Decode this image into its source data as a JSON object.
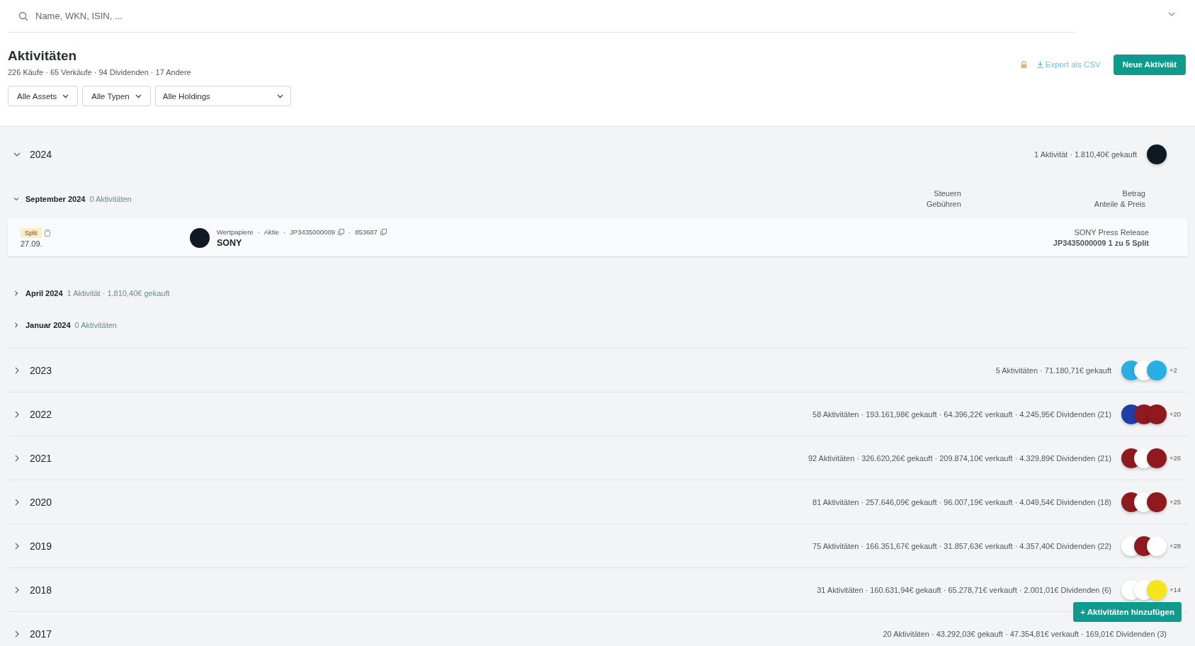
{
  "search": {
    "placeholder": "Name, WKN, ISIN, ..."
  },
  "header": {
    "title": "Aktivitäten",
    "summary": "226 Käufe · 65 Verkäufe · 94 Dividenden · 17 Andere",
    "locked": true,
    "export_label": "Export als CSV",
    "new_button": "Neue Aktivität"
  },
  "filters": [
    {
      "label": "Alle Assets",
      "wide": false
    },
    {
      "label": "Alle Typen",
      "wide": false
    },
    {
      "label": "Alle Holdings",
      "wide": true
    }
  ],
  "years": [
    {
      "year": "2024",
      "expanded": true,
      "summary": "1 Aktivität · 1.810,40€ gekauft",
      "logos": [
        {
          "color": "#0f1b24"
        }
      ],
      "columns": {
        "left": [
          "Steuern",
          "Gebühren"
        ],
        "right": [
          "Betrag",
          "Anteile & Preis"
        ]
      },
      "months": [
        {
          "label": "September 2024",
          "summary": "0 Aktivitäten",
          "expanded": true,
          "entries": [
            {
              "tag": "Split",
              "date": "27.09.",
              "separator": "·",
              "meta": [
                {
                  "text": "Wertpapiere",
                  "copy": false
                },
                {
                  "text": "Aktie",
                  "copy": false
                },
                {
                  "text": "JP3435000009",
                  "copy": true
                },
                {
                  "text": "853687",
                  "copy": true
                }
              ],
              "name": "SONY",
              "note": "SONY Press Release",
              "detail": "JP3435000009 1 zu 5 Split"
            }
          ]
        },
        {
          "label": "April 2024",
          "summary": "1 Aktivität · 1.810,40€ gekauft",
          "expanded": false
        },
        {
          "label": "Januar 2024",
          "summary": "0 Aktivitäten",
          "expanded": false
        }
      ]
    },
    {
      "year": "2023",
      "expanded": false,
      "summary": "5 Aktivitäten · 71.180,71€ gekauft",
      "logos": [
        {
          "color": "#29aee6"
        },
        {
          "color": "#ffffff"
        },
        {
          "color": "#29aee6"
        }
      ],
      "more": "+2"
    },
    {
      "year": "2022",
      "expanded": false,
      "summary": "58 Aktivitäten · 193.161,98€ gekauft · 64.396,22€ verkauft · 4.245,95€ Dividenden (21)",
      "logos": [
        {
          "color": "#1f3fa8"
        },
        {
          "color": "#8e1a1f"
        },
        {
          "color": "#8e1a1f"
        }
      ],
      "more": "+20"
    },
    {
      "year": "2021",
      "expanded": false,
      "summary": "92 Aktivitäten · 326.620,26€ gekauft · 209.874,10€ verkauft · 4.329,89€ Dividenden (21)",
      "logos": [
        {
          "color": "#8e1a1f"
        },
        {
          "color": "#ffffff"
        },
        {
          "color": "#8e1a1f"
        }
      ],
      "more": "+26"
    },
    {
      "year": "2020",
      "expanded": false,
      "summary": "81 Aktivitäten · 257.646,09€ gekauft · 96.007,19€ verkauft · 4.049,54€ Dividenden (18)",
      "logos": [
        {
          "color": "#8e1a1f"
        },
        {
          "color": "#ffffff"
        },
        {
          "color": "#8e1a1f"
        }
      ],
      "more": "+25"
    },
    {
      "year": "2019",
      "expanded": false,
      "summary": "75 Aktivitäten · 166.351,67€ gekauft · 31.857,63€ verkauft · 4.357,40€ Dividenden (22)",
      "logos": [
        {
          "color": "#ffffff"
        },
        {
          "color": "#8e1a1f"
        },
        {
          "color": "#ffffff"
        }
      ],
      "more": "+28"
    },
    {
      "year": "2018",
      "expanded": false,
      "summary": "31 Aktivitäten · 160.631,94€ gekauft · 65.278,71€ verkauft · 2.001,01€ Dividenden (6)",
      "logos": [
        {
          "color": "#ffffff"
        },
        {
          "color": "#ffffff"
        },
        {
          "color": "#f5e51b"
        }
      ],
      "more": "+14"
    },
    {
      "year": "2017",
      "expanded": false,
      "summary": "20 Aktivitäten · 43.292,03€ gekauft · 47.354,81€ verkauft · 169,01€ Dividenden (3)"
    }
  ],
  "add_button": "+ Aktivitäten hinzufügen"
}
